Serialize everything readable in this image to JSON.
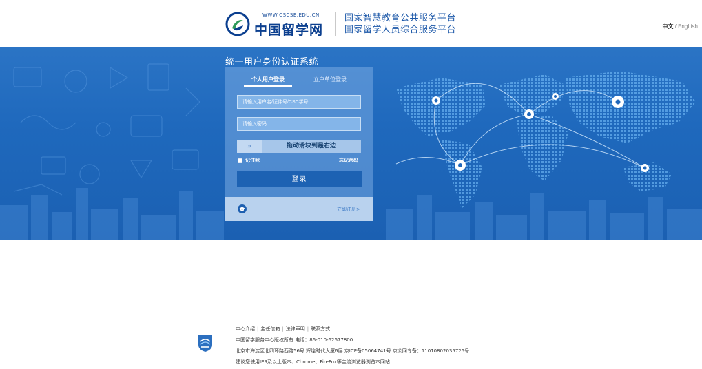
{
  "header": {
    "logo_url": "WWW.CSCSE.EDU.CN",
    "logo_name": "中国留学网",
    "platform_line1": "国家智慧教育公共服务平台",
    "platform_line2": "国家留学人员综合服务平台",
    "lang_zh": "中文",
    "lang_sep": "/",
    "lang_en": "EngLish"
  },
  "login": {
    "system_title": "统一用户身份认证系统",
    "tab_personal": "个人用户登录",
    "tab_org": "立户单位登录",
    "username_placeholder": "请输入用户名/证件号/CSC学号",
    "password_placeholder": "请输入密码",
    "slider_handle": "»",
    "slider_text": "拖动滑块到最右边",
    "remember_label": "记住我",
    "forgot_label": "忘记密码",
    "login_button": "登录",
    "register_link": "立即注册>"
  },
  "footer": {
    "link_about": "中心介绍",
    "link_mailbox": "主任信箱",
    "link_legal": "法律声明",
    "link_contact": "联系方式",
    "copyright": "中国留学服务中心版权所有 电话：86-010-62677800",
    "address": "北京市海淀区北四环路西路56号 辉煌时代大厦6层 京ICP备05064741号 京公网专备：11010802035725号",
    "browser_note": "建议您使用IE9及以上版本、Chrome、FireFox等主流浏览器浏览本网站"
  },
  "colors": {
    "brand_blue": "#1b57a8",
    "banner_blue": "#2b74c5",
    "button_blue": "#1d62b3"
  }
}
